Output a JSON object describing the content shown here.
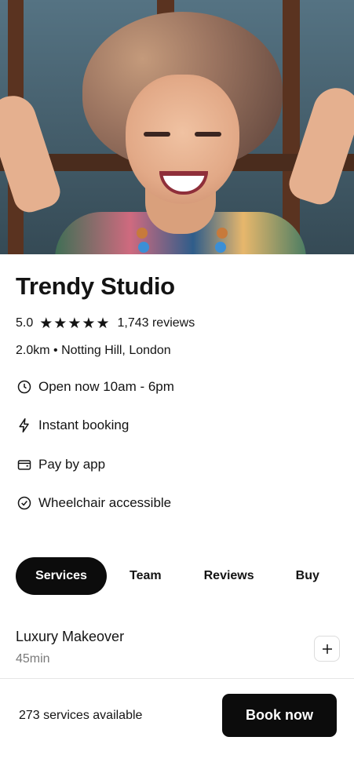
{
  "venue": {
    "name": "Trendy Studio",
    "rating": "5.0",
    "stars": 5,
    "reviews": "1,743 reviews",
    "location": "2.0km • Notting Hill, London"
  },
  "info": [
    {
      "icon": "clock-icon",
      "label": "Open now 10am - 6pm"
    },
    {
      "icon": "lightning-icon",
      "label": "Instant booking"
    },
    {
      "icon": "wallet-icon",
      "label": "Pay by app"
    },
    {
      "icon": "check-circle-icon",
      "label": "Wheelchair accessible"
    }
  ],
  "tabs": [
    "Services",
    "Team",
    "Reviews",
    "Buy"
  ],
  "active_tab": "Services",
  "service": {
    "name": "Luxury Makeover",
    "duration": "45min"
  },
  "footer": {
    "count_text": "273 services available",
    "book_label": "Book now"
  },
  "colors": {
    "primary": "#0c0c0c",
    "text": "#141414",
    "muted": "#7a7a7a"
  }
}
